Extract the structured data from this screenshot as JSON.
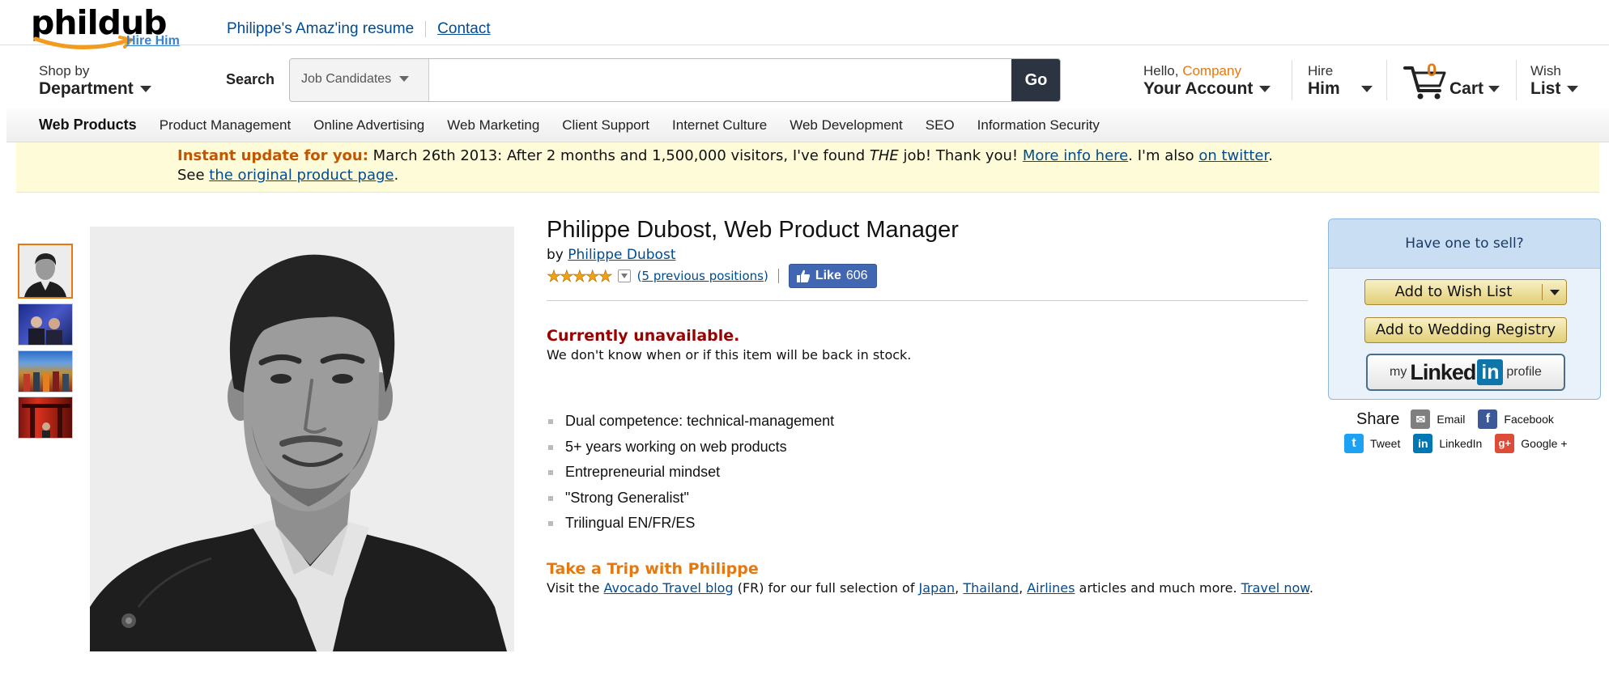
{
  "header": {
    "logo_word": "phildub",
    "logo_tagline": "Hire Him",
    "top_links": {
      "resume": "Philippe's Amaz'ing resume",
      "contact": "Contact"
    }
  },
  "nav": {
    "shop_small": "Shop by",
    "shop_big": "Department",
    "search_label": "Search",
    "search_category": "Job Candidates",
    "search_value": "",
    "go_label": "Go",
    "account_greeting": "Hello,",
    "account_name": "Company",
    "account_big": "Your Account",
    "hire_small": "Hire",
    "hire_big": "Him",
    "cart_count": "0",
    "cart_label": "Cart",
    "wish_small": "Wish",
    "wish_big": "List"
  },
  "category_bar": {
    "title": "Web Products",
    "items": [
      "Product Management",
      "Online Advertising",
      "Web Marketing",
      "Client Support",
      "Internet Culture",
      "Web Development",
      "SEO",
      "Information Security"
    ]
  },
  "banner": {
    "headline": "Instant update for you:",
    "text_1": " March 26th 2013: After 2 months and 1,500,000 visitors, I've found ",
    "emphasis": "THE",
    "text_2": " job! Thank you! ",
    "link_more": "More info here",
    "text_3": ". I'm also ",
    "link_twitter": "on twitter",
    "text_4": ".",
    "line2_prefix": "See ",
    "link_original": "the original product page",
    "line2_suffix": "."
  },
  "product": {
    "title": "Philippe Dubost, Web Product Manager",
    "by_prefix": "by ",
    "author": "Philippe Dubost",
    "stars_text": "★★★★★",
    "rating": 5,
    "positions_open": "(",
    "positions_link": "5 previous positions",
    "positions_close": ")",
    "like_label": "Like",
    "like_count": "606",
    "availability": "Currently unavailable.",
    "availability_note": "We don't know when or if this item will be back in stock.",
    "bullets": [
      "Dual competence: technical-management",
      "5+ years working on web products",
      "Entrepreneurial mindset",
      "\"Strong Generalist\"",
      "Trilingual EN/FR/ES"
    ],
    "trip_title": "Take a Trip with Philippe",
    "trip_pre": "Visit the ",
    "trip_blog": "Avocado Travel blog",
    "trip_mid": " (FR) for our full selection of ",
    "trip_japan": "Japan",
    "trip_comma1": ", ",
    "trip_thailand": "Thailand",
    "trip_comma2": ", ",
    "trip_airlines": "Airlines",
    "trip_post": " articles and much more. ",
    "trip_travel": "Travel now",
    "trip_end": "."
  },
  "buy_box": {
    "heading": "Have one to sell?",
    "wish_button": "Add to Wish List",
    "registry_button": "Add to Wedding Registry",
    "linkedin_my": "my",
    "linkedin_word": "Linked",
    "linkedin_in": "in",
    "linkedin_profile": "profile"
  },
  "share": {
    "label": "Share",
    "email": "Email",
    "facebook": "Facebook",
    "tweet": "Tweet",
    "linkedin": "LinkedIn",
    "google": "Google +",
    "icon_email_glyph": "✉",
    "icon_fb_glyph": "f",
    "icon_tw_glyph": "t",
    "icon_li_glyph": "in",
    "icon_gp_glyph": "g+"
  },
  "colors": {
    "accent_orange": "#e47911",
    "link_blue": "#004b91",
    "unavailable_red": "#990000",
    "banner_yellow": "#fefbd8",
    "go_button": "#2b3440",
    "facebook_blue": "#4267b2",
    "linkedin_blue": "#0e76a8"
  }
}
